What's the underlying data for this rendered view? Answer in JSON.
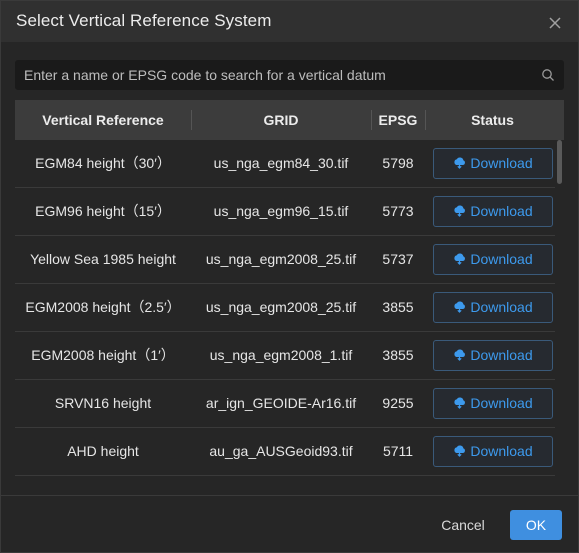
{
  "dialog": {
    "title": "Select Vertical Reference System",
    "close_icon": "close-icon"
  },
  "search": {
    "placeholder": "Enter a name or EPSG code to search for a vertical datum",
    "value": "",
    "icon": "search-icon"
  },
  "table": {
    "columns": [
      "Vertical Reference",
      "GRID",
      "EPSG",
      "Status"
    ],
    "download_label": "Download",
    "download_icon": "cloud-download-icon",
    "rows": [
      {
        "reference": "EGM84 height（30′）",
        "grid": "us_nga_egm84_30.tif",
        "epsg": "5798",
        "status": "Download"
      },
      {
        "reference": "EGM96 height（15′）",
        "grid": "us_nga_egm96_15.tif",
        "epsg": "5773",
        "status": "Download"
      },
      {
        "reference": "Yellow Sea 1985 height",
        "grid": "us_nga_egm2008_25.tif",
        "epsg": "5737",
        "status": "Download"
      },
      {
        "reference": "EGM2008 height（2.5′）",
        "grid": "us_nga_egm2008_25.tif",
        "epsg": "3855",
        "status": "Download"
      },
      {
        "reference": "EGM2008 height（1′）",
        "grid": "us_nga_egm2008_1.tif",
        "epsg": "3855",
        "status": "Download"
      },
      {
        "reference": "SRVN16 height",
        "grid": "ar_ign_GEOIDE-Ar16.tif",
        "epsg": "9255",
        "status": "Download"
      },
      {
        "reference": "AHD height",
        "grid": "au_ga_AUSGeoid93.tif",
        "epsg": "5711",
        "status": "Download"
      }
    ]
  },
  "footer": {
    "cancel_label": "Cancel",
    "ok_label": "OK"
  },
  "colors": {
    "accent": "#3f8fe0",
    "link": "#3d9aed",
    "background": "#262626",
    "header_bg": "#3c3c3c"
  }
}
